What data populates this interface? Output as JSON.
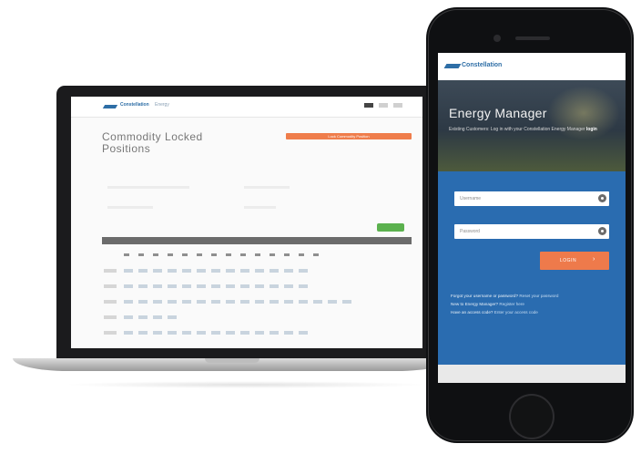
{
  "laptop": {
    "brand": "Constellation",
    "brand_sub": "Energy",
    "page_title": "Commodity Locked Positions",
    "orange_button": "Lock Commodity Position"
  },
  "phone": {
    "brand": "Constellation",
    "title": "Energy Manager",
    "subtitle_prefix": "Existing Customers: Log in with your Constellation Energy Manager",
    "subtitle_bold": "login",
    "username_placeholder": "Username",
    "password_placeholder": "Password",
    "login_label": "LOGIN",
    "login_chevron": "›",
    "links": [
      {
        "text": "Forgot your username or password?",
        "link": "Reset your password"
      },
      {
        "text": "New to Energy Manager?",
        "link": "Register here"
      },
      {
        "text": "Have an access code?",
        "link": "Enter your access code"
      }
    ]
  },
  "colors": {
    "brand_blue": "#2e6ea6",
    "login_orange": "#ee7a4b",
    "panel_blue": "#2a6cb0",
    "status_green": "#5bb14e"
  },
  "icons": {
    "username_field": "user-icon",
    "password_field": "lock-icon"
  }
}
